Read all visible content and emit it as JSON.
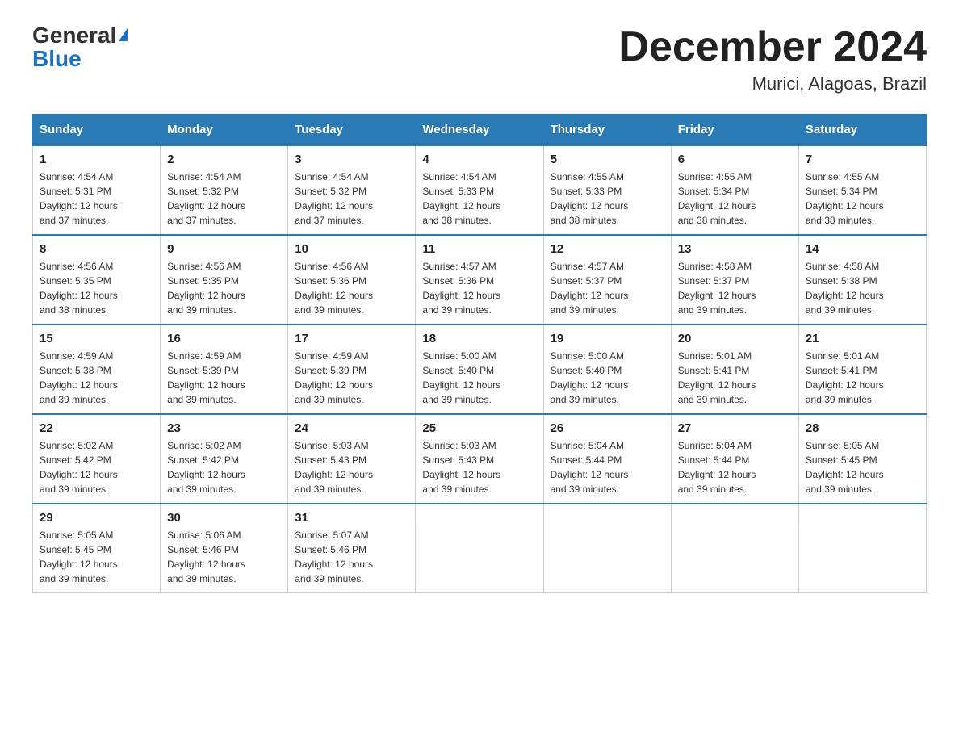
{
  "header": {
    "logo_general": "General",
    "logo_blue": "Blue",
    "title": "December 2024",
    "subtitle": "Murici, Alagoas, Brazil"
  },
  "days_of_week": [
    "Sunday",
    "Monday",
    "Tuesday",
    "Wednesday",
    "Thursday",
    "Friday",
    "Saturday"
  ],
  "weeks": [
    [
      {
        "day": "1",
        "sunrise": "4:54 AM",
        "sunset": "5:31 PM",
        "daylight": "12 hours and 37 minutes."
      },
      {
        "day": "2",
        "sunrise": "4:54 AM",
        "sunset": "5:32 PM",
        "daylight": "12 hours and 37 minutes."
      },
      {
        "day": "3",
        "sunrise": "4:54 AM",
        "sunset": "5:32 PM",
        "daylight": "12 hours and 37 minutes."
      },
      {
        "day": "4",
        "sunrise": "4:54 AM",
        "sunset": "5:33 PM",
        "daylight": "12 hours and 38 minutes."
      },
      {
        "day": "5",
        "sunrise": "4:55 AM",
        "sunset": "5:33 PM",
        "daylight": "12 hours and 38 minutes."
      },
      {
        "day": "6",
        "sunrise": "4:55 AM",
        "sunset": "5:34 PM",
        "daylight": "12 hours and 38 minutes."
      },
      {
        "day": "7",
        "sunrise": "4:55 AM",
        "sunset": "5:34 PM",
        "daylight": "12 hours and 38 minutes."
      }
    ],
    [
      {
        "day": "8",
        "sunrise": "4:56 AM",
        "sunset": "5:35 PM",
        "daylight": "12 hours and 38 minutes."
      },
      {
        "day": "9",
        "sunrise": "4:56 AM",
        "sunset": "5:35 PM",
        "daylight": "12 hours and 39 minutes."
      },
      {
        "day": "10",
        "sunrise": "4:56 AM",
        "sunset": "5:36 PM",
        "daylight": "12 hours and 39 minutes."
      },
      {
        "day": "11",
        "sunrise": "4:57 AM",
        "sunset": "5:36 PM",
        "daylight": "12 hours and 39 minutes."
      },
      {
        "day": "12",
        "sunrise": "4:57 AM",
        "sunset": "5:37 PM",
        "daylight": "12 hours and 39 minutes."
      },
      {
        "day": "13",
        "sunrise": "4:58 AM",
        "sunset": "5:37 PM",
        "daylight": "12 hours and 39 minutes."
      },
      {
        "day": "14",
        "sunrise": "4:58 AM",
        "sunset": "5:38 PM",
        "daylight": "12 hours and 39 minutes."
      }
    ],
    [
      {
        "day": "15",
        "sunrise": "4:59 AM",
        "sunset": "5:38 PM",
        "daylight": "12 hours and 39 minutes."
      },
      {
        "day": "16",
        "sunrise": "4:59 AM",
        "sunset": "5:39 PM",
        "daylight": "12 hours and 39 minutes."
      },
      {
        "day": "17",
        "sunrise": "4:59 AM",
        "sunset": "5:39 PM",
        "daylight": "12 hours and 39 minutes."
      },
      {
        "day": "18",
        "sunrise": "5:00 AM",
        "sunset": "5:40 PM",
        "daylight": "12 hours and 39 minutes."
      },
      {
        "day": "19",
        "sunrise": "5:00 AM",
        "sunset": "5:40 PM",
        "daylight": "12 hours and 39 minutes."
      },
      {
        "day": "20",
        "sunrise": "5:01 AM",
        "sunset": "5:41 PM",
        "daylight": "12 hours and 39 minutes."
      },
      {
        "day": "21",
        "sunrise": "5:01 AM",
        "sunset": "5:41 PM",
        "daylight": "12 hours and 39 minutes."
      }
    ],
    [
      {
        "day": "22",
        "sunrise": "5:02 AM",
        "sunset": "5:42 PM",
        "daylight": "12 hours and 39 minutes."
      },
      {
        "day": "23",
        "sunrise": "5:02 AM",
        "sunset": "5:42 PM",
        "daylight": "12 hours and 39 minutes."
      },
      {
        "day": "24",
        "sunrise": "5:03 AM",
        "sunset": "5:43 PM",
        "daylight": "12 hours and 39 minutes."
      },
      {
        "day": "25",
        "sunrise": "5:03 AM",
        "sunset": "5:43 PM",
        "daylight": "12 hours and 39 minutes."
      },
      {
        "day": "26",
        "sunrise": "5:04 AM",
        "sunset": "5:44 PM",
        "daylight": "12 hours and 39 minutes."
      },
      {
        "day": "27",
        "sunrise": "5:04 AM",
        "sunset": "5:44 PM",
        "daylight": "12 hours and 39 minutes."
      },
      {
        "day": "28",
        "sunrise": "5:05 AM",
        "sunset": "5:45 PM",
        "daylight": "12 hours and 39 minutes."
      }
    ],
    [
      {
        "day": "29",
        "sunrise": "5:05 AM",
        "sunset": "5:45 PM",
        "daylight": "12 hours and 39 minutes."
      },
      {
        "day": "30",
        "sunrise": "5:06 AM",
        "sunset": "5:46 PM",
        "daylight": "12 hours and 39 minutes."
      },
      {
        "day": "31",
        "sunrise": "5:07 AM",
        "sunset": "5:46 PM",
        "daylight": "12 hours and 39 minutes."
      },
      null,
      null,
      null,
      null
    ]
  ],
  "labels": {
    "sunrise": "Sunrise:",
    "sunset": "Sunset:",
    "daylight": "Daylight:"
  }
}
